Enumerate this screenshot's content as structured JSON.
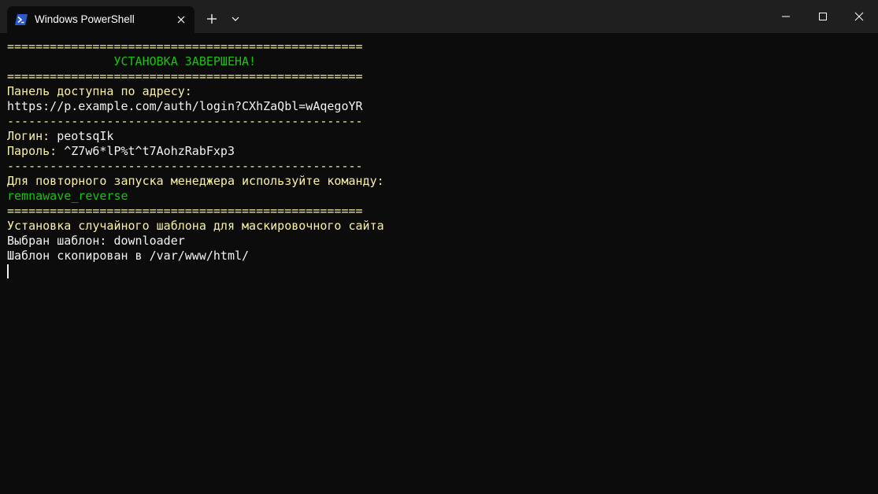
{
  "window": {
    "tab_title": "Windows PowerShell"
  },
  "icons": {
    "tab_icon": "powershell-icon",
    "tab_close": "close-icon",
    "new_tab": "plus-icon",
    "dropdown": "chevron-down-icon",
    "minimize": "minimize-icon",
    "maximize": "maximize-icon",
    "close": "close-icon"
  },
  "colors": {
    "background": "#0c0c0c",
    "titlebar": "#1f1f1f",
    "yellow_text": "#f9f1a5",
    "white_text": "#f2f2f2",
    "green_text": "#16c60c"
  },
  "terminal": {
    "lines": [
      "==================================================",
      "               УСТАНОВКА ЗАВЕРШЕНА!",
      "==================================================",
      "Панель доступна по адресу:",
      "https://p.example.com/auth/login?CXhZaQbl=wAqegoYR",
      "--------------------------------------------------",
      "Логин: ",
      "peotsqIk",
      "Пароль: ",
      "^Z7w6*lP%t^t7AohzRabFxp3",
      "--------------------------------------------------",
      "Для повторного запуска менеджера используйте команду:",
      "remnawave_reverse",
      "==================================================",
      "Установка случайного шаблона для маскировочного сайта",
      "Выбран шаблон: downloader",
      "Шаблон скопирован в /var/www/html/"
    ]
  }
}
